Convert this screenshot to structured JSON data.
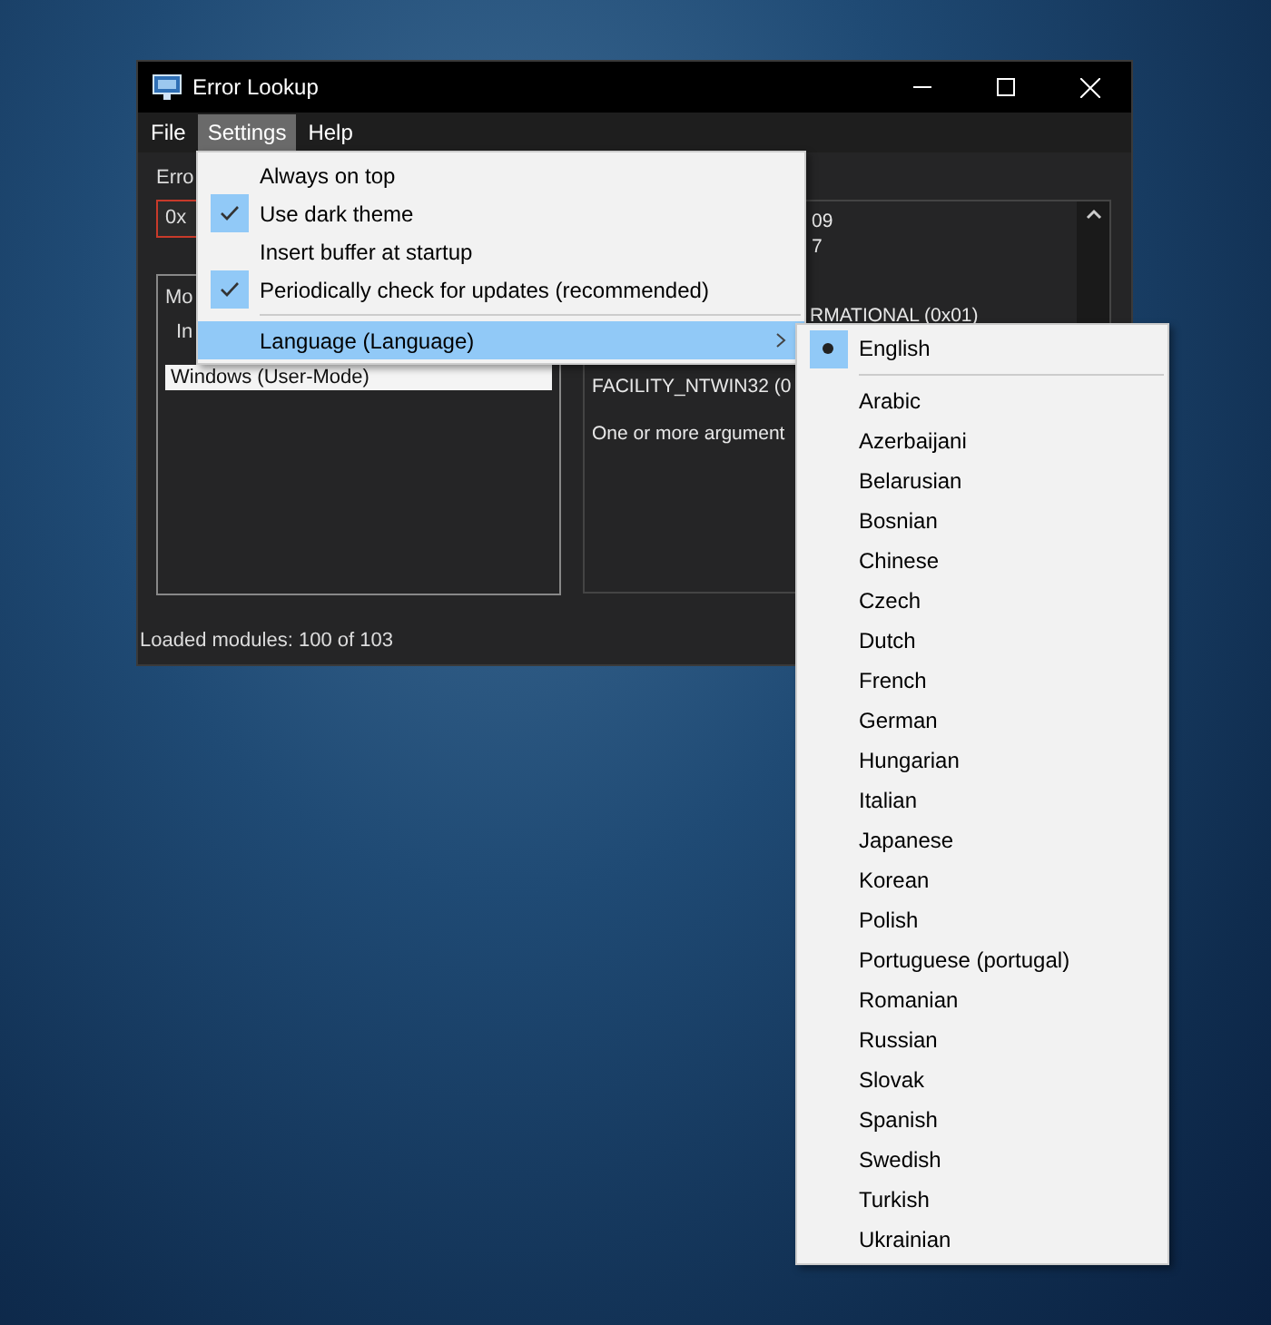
{
  "window": {
    "title": "Error Lookup"
  },
  "menu_bar": [
    {
      "label": "File",
      "selected": false
    },
    {
      "label": "Settings",
      "selected": true
    },
    {
      "label": "Help",
      "selected": false
    }
  ],
  "error_label": "Erro",
  "code_input": {
    "value": "0x"
  },
  "modules_group": {
    "title": "Mo",
    "header": "In",
    "rows": [
      {
        "text": "Windows (User-Mode)",
        "selected": true
      }
    ]
  },
  "result_lines": [
    "09",
    "7",
    "RMATIONAL (0x01)",
    "FACILITY_NTWIN32 (0",
    "One or more argument"
  ],
  "status_bar": "Loaded modules: 100 of 103",
  "settings_menu": [
    {
      "kind": "item",
      "label": "Always on top",
      "checked": false
    },
    {
      "kind": "item",
      "label": "Use dark theme",
      "checked": true
    },
    {
      "kind": "item",
      "label": "Insert buffer at startup",
      "checked": false
    },
    {
      "kind": "item",
      "label": "Periodically check for updates (recommended)",
      "checked": true
    },
    {
      "kind": "submenu",
      "label": "Language (Language)",
      "checked": false
    }
  ],
  "language_menu": [
    {
      "label": "English",
      "selected": true
    },
    {
      "label": "Arabic",
      "selected": false
    },
    {
      "label": "Azerbaijani",
      "selected": false
    },
    {
      "label": "Belarusian",
      "selected": false
    },
    {
      "label": "Bosnian",
      "selected": false
    },
    {
      "label": "Chinese",
      "selected": false
    },
    {
      "label": "Czech",
      "selected": false
    },
    {
      "label": "Dutch",
      "selected": false
    },
    {
      "label": "French",
      "selected": false
    },
    {
      "label": "German",
      "selected": false
    },
    {
      "label": "Hungarian",
      "selected": false
    },
    {
      "label": "Italian",
      "selected": false
    },
    {
      "label": "Japanese",
      "selected": false
    },
    {
      "label": "Korean",
      "selected": false
    },
    {
      "label": "Polish",
      "selected": false
    },
    {
      "label": "Portuguese (portugal)",
      "selected": false
    },
    {
      "label": "Romanian",
      "selected": false
    },
    {
      "label": "Russian",
      "selected": false
    },
    {
      "label": "Slovak",
      "selected": false
    },
    {
      "label": "Spanish",
      "selected": false
    },
    {
      "label": "Swedish",
      "selected": false
    },
    {
      "label": "Turkish",
      "selected": false
    },
    {
      "label": "Ukrainian",
      "selected": false
    }
  ]
}
